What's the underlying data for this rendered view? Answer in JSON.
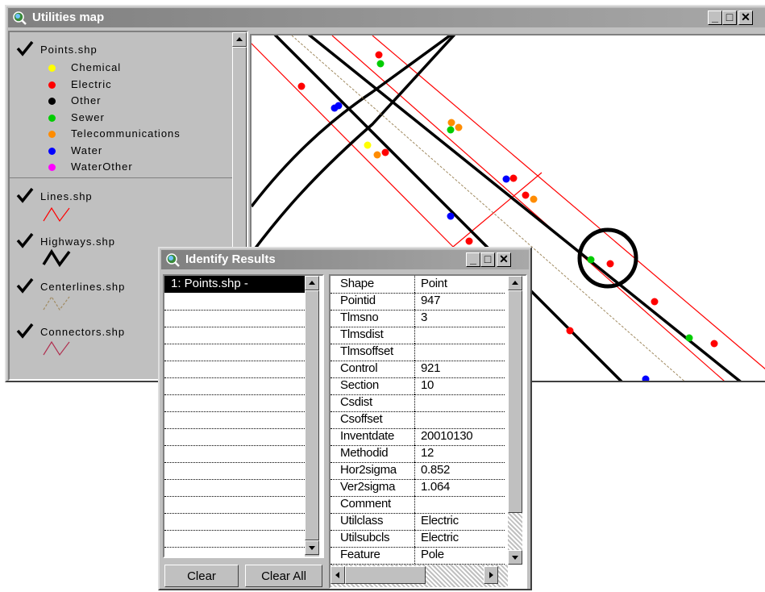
{
  "map_window": {
    "title": "Utilities map",
    "legend": {
      "points_layer": "Points.shp",
      "point_classes": [
        {
          "label": "Chemical",
          "color": "#ffff00"
        },
        {
          "label": "Electric",
          "color": "#ff0000"
        },
        {
          "label": "Other",
          "color": "#000000"
        },
        {
          "label": "Sewer",
          "color": "#00cc00"
        },
        {
          "label": "Telecommunications",
          "color": "#ff8c00"
        },
        {
          "label": "Water",
          "color": "#0000ff"
        },
        {
          "label": "WaterOther",
          "color": "#ff00ff"
        }
      ],
      "lines_layer": "Lines.shp",
      "highways_layer": "Highways.shp",
      "centerlines_layer": "Centerlines.shp",
      "connectors_layer": "Connectors.shp"
    }
  },
  "identify_window": {
    "title": "Identify Results",
    "list_items": [
      "1:  Points.shp -"
    ],
    "attributes": [
      {
        "field": "Shape",
        "value": "Point"
      },
      {
        "field": "Pointid",
        "value": "947"
      },
      {
        "field": "Tlmsno",
        "value": "3"
      },
      {
        "field": "Tlmsdist",
        "value": ""
      },
      {
        "field": "Tlmsoffset",
        "value": ""
      },
      {
        "field": "Control",
        "value": "921"
      },
      {
        "field": "Section",
        "value": "10"
      },
      {
        "field": "Csdist",
        "value": ""
      },
      {
        "field": "Csoffset",
        "value": ""
      },
      {
        "field": "Inventdate",
        "value": "20010130"
      },
      {
        "field": "Methodid",
        "value": "12"
      },
      {
        "field": "Hor2sigma",
        "value": "0.852"
      },
      {
        "field": "Ver2sigma",
        "value": "1.064"
      },
      {
        "field": "Comment",
        "value": ""
      },
      {
        "field": "Utilclass",
        "value": "Electric"
      },
      {
        "field": "Utilsubcls",
        "value": "Electric"
      },
      {
        "field": "Feature",
        "value": "Pole"
      }
    ],
    "clear_label": "Clear",
    "clear_all_label": "Clear All"
  },
  "icons": {
    "window_icon": "globe-magnifier-icon",
    "checkbox": "checkmark-icon"
  }
}
